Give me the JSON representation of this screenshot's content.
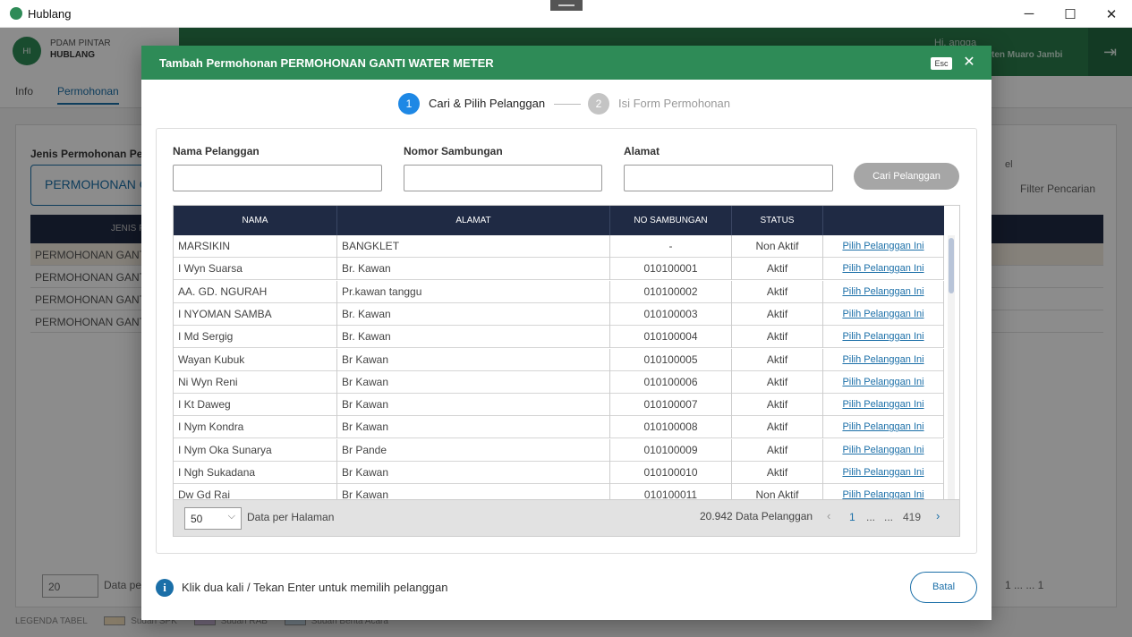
{
  "window": {
    "title": "Hublang",
    "controls": {
      "minimize": "─",
      "maximize": "☐",
      "close": "✕"
    }
  },
  "background": {
    "brand_line1": "PDAM PINTAR",
    "brand_line2": "HUBLANG",
    "logo_text": "HI",
    "user_greeting": "Hi, angga",
    "location": "ten Muaro Jambi",
    "tabs": [
      "Info",
      "Permohonan"
    ],
    "jenis_label": "Jenis Permohonan Pela",
    "jenis_value": "PERMOHONAN G",
    "tool_label": "el",
    "filter_label": "Filter Pencarian",
    "table_header": "JENIS P",
    "rows": [
      "PERMOHONAN GANTI",
      "PERMOHONAN GANTI",
      "PERMOHONAN GANTI",
      "PERMOHONAN GANTI"
    ],
    "footer_per_page": "20",
    "footer_label": "Data per",
    "footer_pagination": "1   ...   ...   1",
    "legend_label": "LEGENDA TABEL",
    "legend_items": [
      "Sudah SPK",
      "Sudah RAB",
      "Sudah Berita Acara"
    ]
  },
  "modal": {
    "title": "Tambah Permohonan PERMOHONAN GANTI WATER METER",
    "esc_badge": "Esc",
    "close_icon": "✕",
    "steps": [
      {
        "number": "1",
        "label": "Cari & Pilih Pelanggan",
        "active": true
      },
      {
        "number": "2",
        "label": "Isi Form Permohonan",
        "active": false
      }
    ],
    "colors": {
      "primary": "#2e8b57",
      "accent": "#1b6fa8",
      "step_active": "#1e88e5",
      "step_inactive": "#c4c4c4"
    },
    "search": {
      "nama_label": "Nama Pelanggan",
      "nama_value": "",
      "sambungan_label": "Nomor Sambungan",
      "sambungan_value": "",
      "alamat_label": "Alamat",
      "alamat_value": "",
      "button": "Cari Pelanggan"
    },
    "table": {
      "columns": [
        "NAMA",
        "ALAMAT",
        "NO SAMBUNGAN",
        "STATUS",
        ""
      ],
      "action_label": "Pilih Pelanggan Ini",
      "rows": [
        {
          "nama": "MARSIKIN",
          "alamat": "BANGKLET",
          "no": "-",
          "status": "Non Aktif"
        },
        {
          "nama": "I Wyn Suarsa",
          "alamat": "Br. Kawan",
          "no": "010100001",
          "status": "Aktif"
        },
        {
          "nama": "AA. GD. NGURAH",
          "alamat": "Pr.kawan tanggu",
          "no": "010100002",
          "status": "Aktif"
        },
        {
          "nama": "I NYOMAN SAMBA",
          "alamat": "Br. Kawan",
          "no": "010100003",
          "status": "Aktif"
        },
        {
          "nama": "I Md Sergig",
          "alamat": "Br. Kawan",
          "no": "010100004",
          "status": "Aktif"
        },
        {
          "nama": "Wayan Kubuk",
          "alamat": "Br Kawan",
          "no": "010100005",
          "status": "Aktif"
        },
        {
          "nama": "Ni Wyn Reni",
          "alamat": "Br Kawan",
          "no": "010100006",
          "status": "Aktif"
        },
        {
          "nama": "I Kt Daweg",
          "alamat": "Br Kawan",
          "no": "010100007",
          "status": "Aktif"
        },
        {
          "nama": "I Nym Kondra",
          "alamat": "Br Kawan",
          "no": "010100008",
          "status": "Aktif"
        },
        {
          "nama": "I Nym Oka Sunarya",
          "alamat": "Br Pande",
          "no": "010100009",
          "status": "Aktif"
        },
        {
          "nama": "I Ngh Sukadana",
          "alamat": "Br Kawan",
          "no": "010100010",
          "status": "Aktif"
        },
        {
          "nama": "Dw Gd Rai",
          "alamat": "Br Kawan",
          "no": "010100011",
          "status": "Non Aktif"
        }
      ]
    },
    "footer": {
      "per_page": "50",
      "per_page_label": "Data per Halaman",
      "total": "20.942 Data Pelanggan",
      "page_current": "1",
      "page_ellipsis1": "...",
      "page_ellipsis2": "...",
      "page_last": "419",
      "prev_icon": "‹",
      "next_icon": "›"
    },
    "hint": "Klik dua kali  / Tekan Enter untuk memilih pelanggan",
    "cancel_button": "Batal"
  }
}
